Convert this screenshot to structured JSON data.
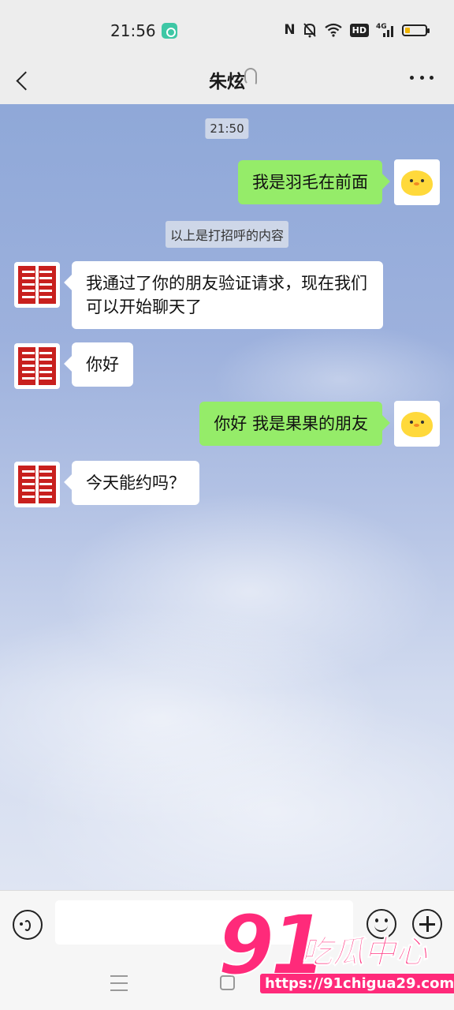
{
  "status_bar": {
    "time": "21:56",
    "app_notification_icon": "app-notification-icon",
    "icons": [
      "nfc-icon",
      "mute-bell-icon",
      "wifi-icon",
      "hd-icon",
      "4g-signal-icon",
      "battery-icon"
    ],
    "nfc_text": "N",
    "hd_text": "HD",
    "network_text": "4G"
  },
  "title_bar": {
    "back_icon": "chevron-left-icon",
    "contact_name": "朱炫",
    "earpiece_icon": "ear-icon",
    "more_icon": "more-dots-icon"
  },
  "chat": {
    "timestamp": "21:50",
    "system_notice": "以上是打招呼的内容",
    "messages": [
      {
        "from": "self",
        "text": "我是羽毛在前面"
      },
      {
        "from": "other",
        "text": "我通过了你的朋友验证请求，现在我们可以开始聊天了"
      },
      {
        "from": "other",
        "text": "你好"
      },
      {
        "from": "self",
        "text": "你好 我是果果的朋友"
      },
      {
        "from": "other",
        "text": "今天能约吗？"
      }
    ],
    "colors": {
      "self_bubble": "#95ec69",
      "other_bubble": "#ffffff",
      "seal_red": "#c8201e"
    }
  },
  "input_bar": {
    "voice_icon": "voice-icon",
    "input_value": "",
    "emoji_icon": "emoji-icon",
    "plus_icon": "plus-icon"
  },
  "nav_bar": {
    "icons": [
      "menu-icon",
      "home-icon"
    ]
  },
  "watermark": {
    "number": "91",
    "text": "吃瓜中心",
    "url": "https://91chigua29.com",
    "color": "#ff2a7a"
  }
}
